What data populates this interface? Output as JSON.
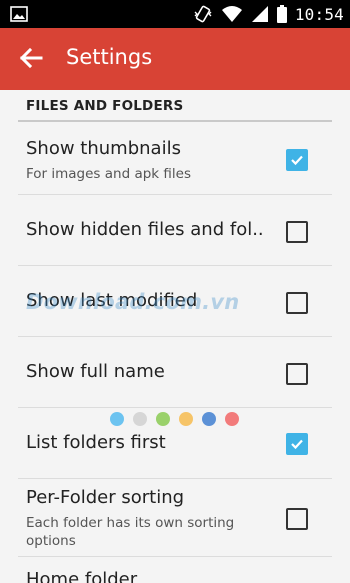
{
  "status_bar": {
    "time": "10:54",
    "icons": [
      "image-icon",
      "phone-vibrate-icon",
      "wifi-icon",
      "signal-icon",
      "battery-icon"
    ]
  },
  "app_bar": {
    "title": "Settings",
    "back_icon": "arrow-back-icon",
    "color": "#d84335"
  },
  "section": {
    "title": "FILES AND FOLDERS"
  },
  "settings": [
    {
      "title": "Show thumbnails",
      "subtitle": "For images and apk files",
      "checked": true
    },
    {
      "title": "Show hidden files and fol..",
      "subtitle": "",
      "checked": false
    },
    {
      "title": "Show last modified",
      "subtitle": "",
      "checked": false
    },
    {
      "title": "Show full name",
      "subtitle": "",
      "checked": false
    },
    {
      "title": "List folders first",
      "subtitle": "",
      "checked": true
    },
    {
      "title": "Per-Folder sorting",
      "subtitle": "Each folder has its own sorting options",
      "checked": false
    },
    {
      "title": "Home folder",
      "subtitle": "",
      "checked": false
    }
  ],
  "watermark": {
    "text": "Download.com.vn",
    "dot_colors": [
      "#6cc3f0",
      "#d6d6d6",
      "#9ad16b",
      "#f6c468",
      "#5c91d6",
      "#f27b7b"
    ]
  },
  "accent_color": "#3fb3e6"
}
